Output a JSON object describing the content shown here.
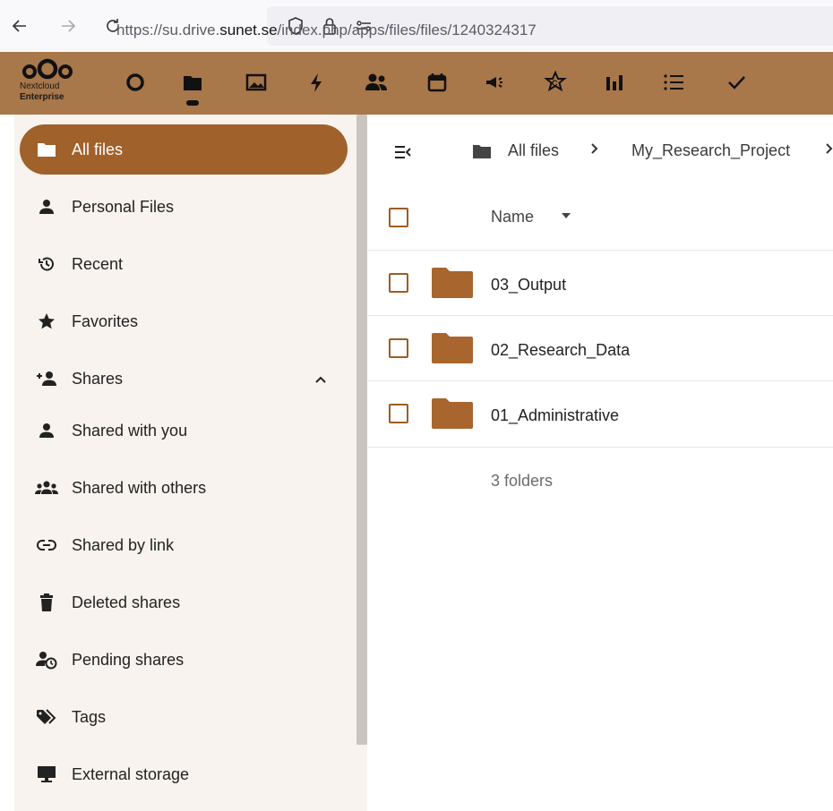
{
  "browser": {
    "url_prefix": "https://su.drive.",
    "url_domain": "sunet.se",
    "url_suffix": "/index.php/apps/files/files/1240324317"
  },
  "app": {
    "logo_line1": "Nextcloud",
    "logo_line2": "Enterprise"
  },
  "sidebar": {
    "items": [
      {
        "label": "All files",
        "icon": "folder-icon"
      },
      {
        "label": "Personal Files",
        "icon": "person-icon"
      },
      {
        "label": "Recent",
        "icon": "history-icon"
      },
      {
        "label": "Favorites",
        "icon": "star-icon"
      },
      {
        "label": "Shares",
        "icon": "share-add-icon"
      },
      {
        "label": "Shared with you",
        "icon": "person-icon"
      },
      {
        "label": "Shared with others",
        "icon": "group-icon"
      },
      {
        "label": "Shared by link",
        "icon": "link-icon"
      },
      {
        "label": "Deleted shares",
        "icon": "trash-icon"
      },
      {
        "label": "Pending shares",
        "icon": "pending-icon"
      },
      {
        "label": "Tags",
        "icon": "tag-icon"
      },
      {
        "label": "External storage",
        "icon": "monitor-icon"
      }
    ]
  },
  "breadcrumb": {
    "root": "All files",
    "folder": "My_Research_Project"
  },
  "table": {
    "name_header": "Name",
    "rows": [
      "03_Output",
      "02_Research_Data",
      "01_Administrative"
    ],
    "summary": "3 folders"
  },
  "colors": {
    "header": "#a8774a",
    "accent": "#a0612a",
    "folder": "#a8652e",
    "sidebar": "#f8f3ee"
  }
}
